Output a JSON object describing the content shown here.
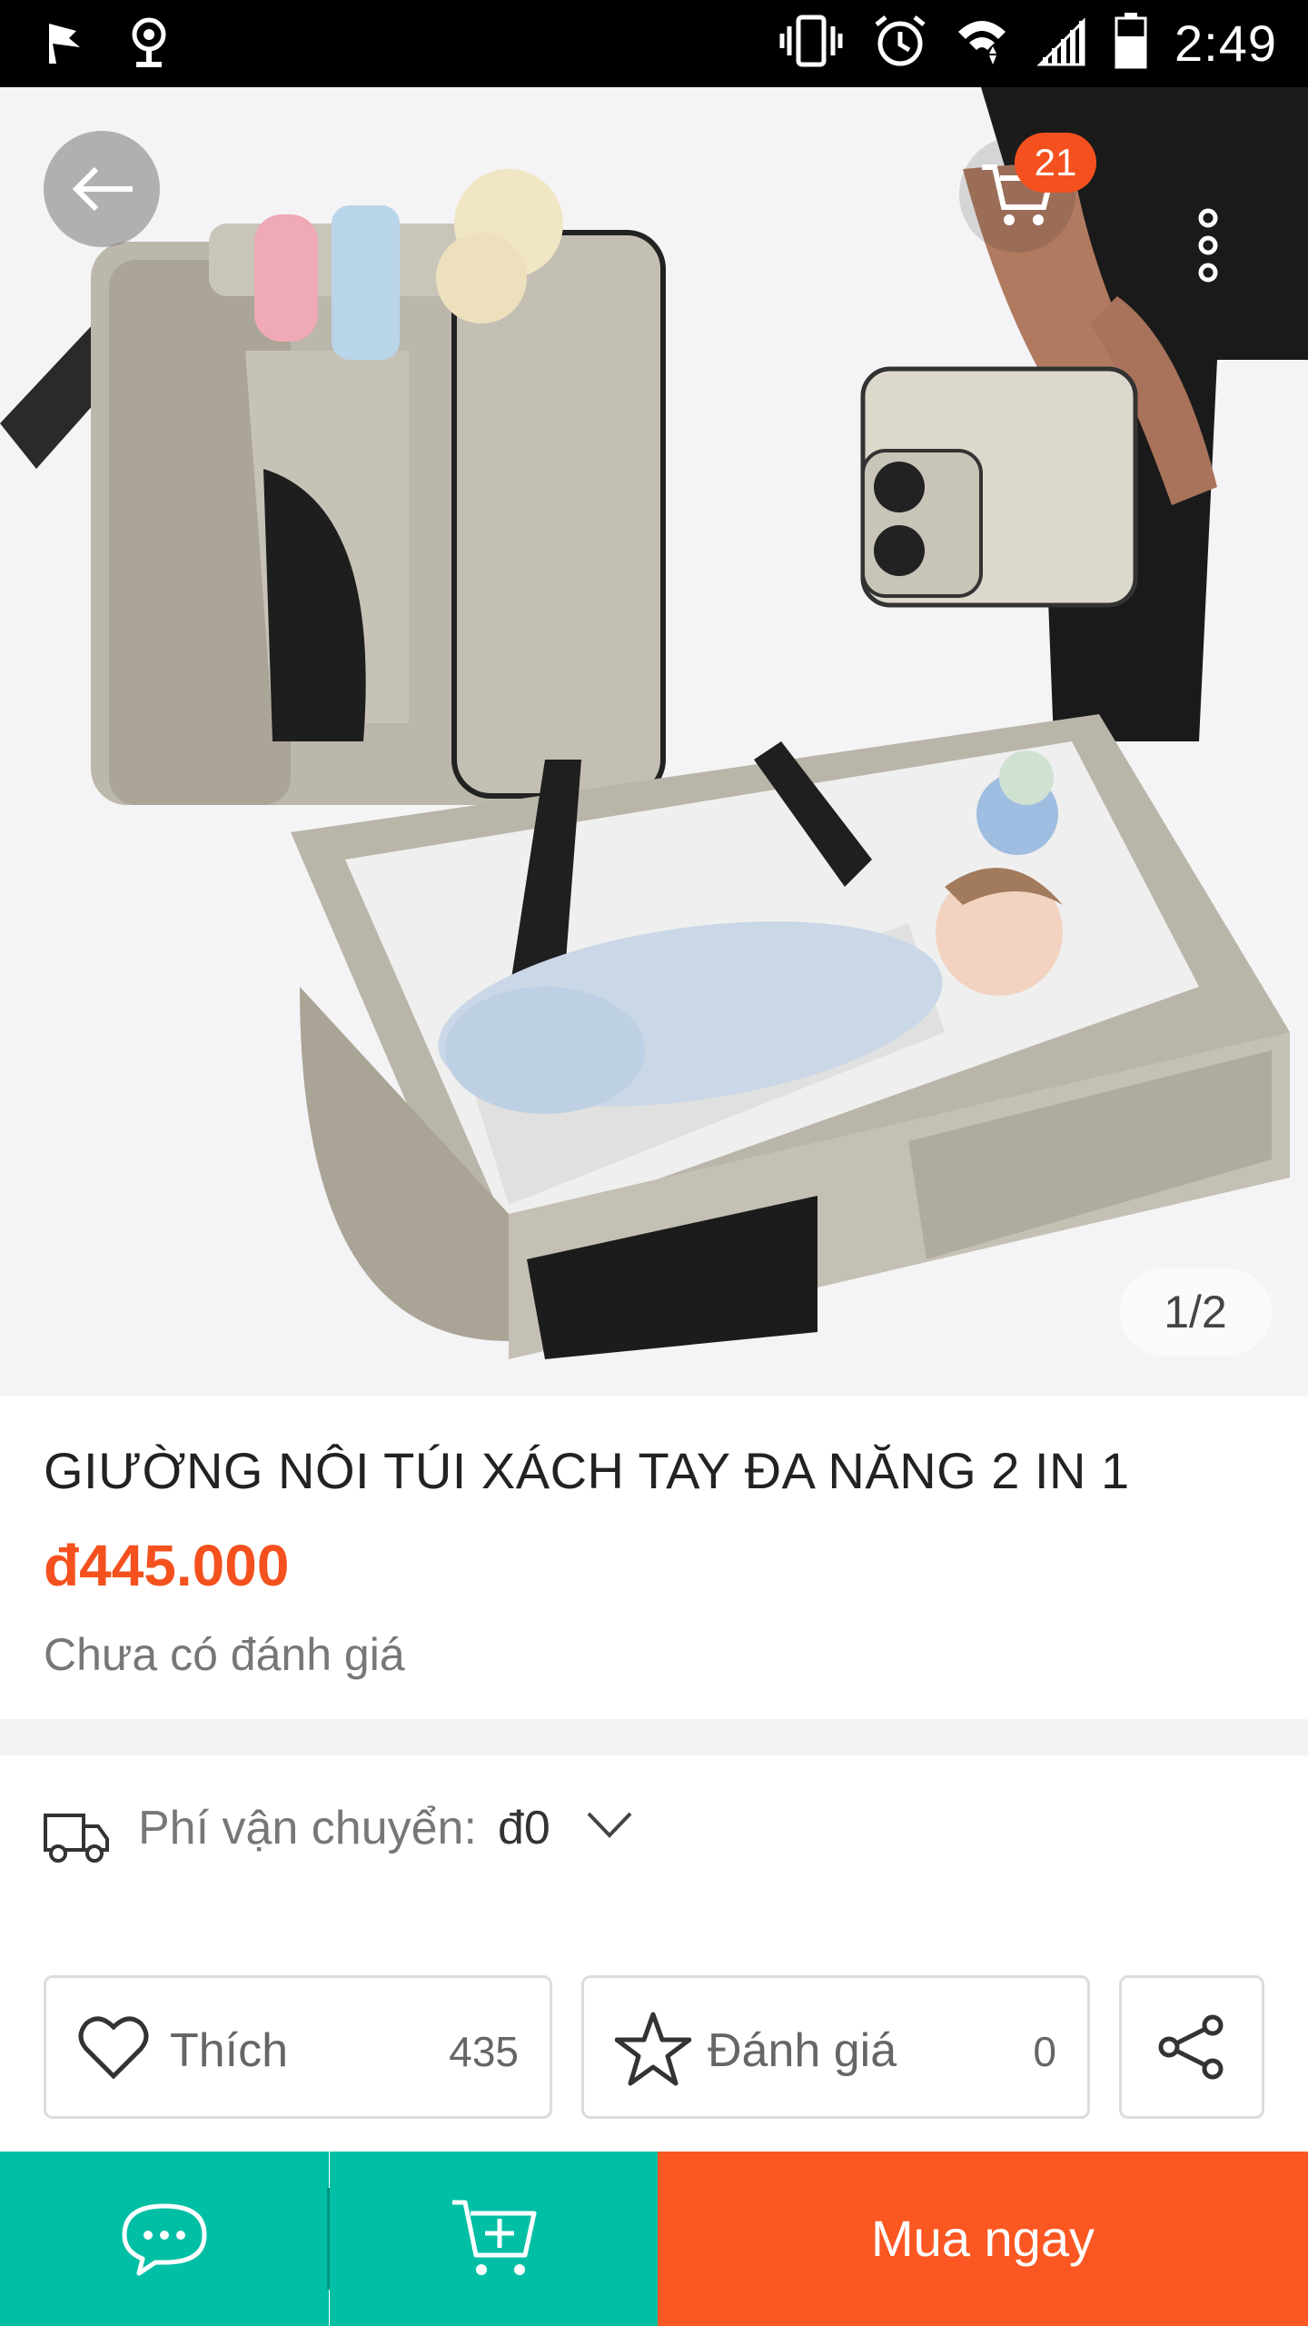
{
  "status_bar": {
    "time": "2:49"
  },
  "hero": {
    "cart_count": "21",
    "pager": "1/2"
  },
  "product": {
    "title": "GIƯỜNG NÔI TÚI XÁCH TAY ĐA NĂNG 2 IN 1",
    "price": "đ445.000",
    "rating_text": "Chưa có đánh giá"
  },
  "shipping": {
    "label": "Phí vận chuyển:",
    "value": "đ0"
  },
  "actions": {
    "like_label": "Thích",
    "like_count": "435",
    "rate_label": "Đánh giá",
    "rate_count": "0"
  },
  "bottom_bar": {
    "buy_label": "Mua ngay"
  },
  "colors": {
    "accent": "#f4511e",
    "teal": "#00bfa5",
    "buy": "#fb5722"
  }
}
